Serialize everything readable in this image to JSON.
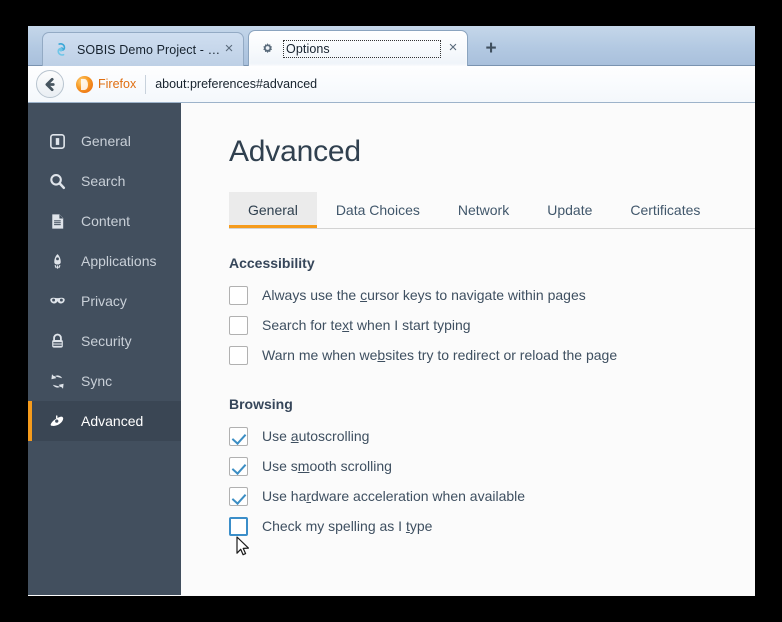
{
  "browser": {
    "tabs": [
      {
        "title": "SOBIS Demo Project - PIRS ...",
        "favicon": "sobis-favicon",
        "close": "×",
        "active": false
      },
      {
        "title": "Options",
        "favicon": "gear-icon",
        "close": "×",
        "active": true
      }
    ],
    "new_tab_label": "+",
    "back_label": "←",
    "brand_label": "Firefox",
    "url": "about:preferences#advanced"
  },
  "sidebar": {
    "items": [
      {
        "label": "General",
        "icon": "general-icon"
      },
      {
        "label": "Search",
        "icon": "search-icon"
      },
      {
        "label": "Content",
        "icon": "content-icon"
      },
      {
        "label": "Applications",
        "icon": "applications-icon"
      },
      {
        "label": "Privacy",
        "icon": "privacy-mask-icon"
      },
      {
        "label": "Security",
        "icon": "security-lock-icon"
      },
      {
        "label": "Sync",
        "icon": "sync-icon"
      },
      {
        "label": "Advanced",
        "icon": "advanced-flask-icon"
      }
    ],
    "selected_index": 7
  },
  "main": {
    "title": "Advanced",
    "tabs": [
      {
        "label": "General",
        "active": true
      },
      {
        "label": "Data Choices",
        "active": false
      },
      {
        "label": "Network",
        "active": false
      },
      {
        "label": "Update",
        "active": false
      },
      {
        "label": "Certificates",
        "active": false
      }
    ],
    "sections": [
      {
        "title": "Accessibility",
        "options": [
          {
            "pre": "Always use the ",
            "key": "c",
            "post": "ursor keys to navigate within pages",
            "checked": false,
            "focused": false
          },
          {
            "pre": "Search for te",
            "key": "x",
            "post": "t when I start typing",
            "checked": false,
            "focused": false
          },
          {
            "pre": "Warn me when we",
            "key": "b",
            "post": "sites try to redirect or reload the page",
            "checked": false,
            "focused": false
          }
        ]
      },
      {
        "title": "Browsing",
        "options": [
          {
            "pre": "Use ",
            "key": "a",
            "post": "utoscrolling",
            "checked": true,
            "focused": false
          },
          {
            "pre": "Use s",
            "key": "m",
            "post": "ooth scrolling",
            "checked": true,
            "focused": false
          },
          {
            "pre": "Use ha",
            "key": "r",
            "post": "dware acceleration when available",
            "checked": true,
            "focused": false
          },
          {
            "pre": "Check my spelling as I ",
            "key": "t",
            "post": "ype",
            "checked": false,
            "focused": true
          }
        ]
      }
    ]
  },
  "colors": {
    "sidebar_bg": "#424f5e",
    "sidebar_selected_bg": "#3a4654",
    "accent_orange": "#f59b1c",
    "checkbox_check": "#3c8ec4",
    "focus_blue": "#3b8ec9",
    "brand_orange": "#e06f12",
    "page_bg": "#fbfbfb"
  }
}
